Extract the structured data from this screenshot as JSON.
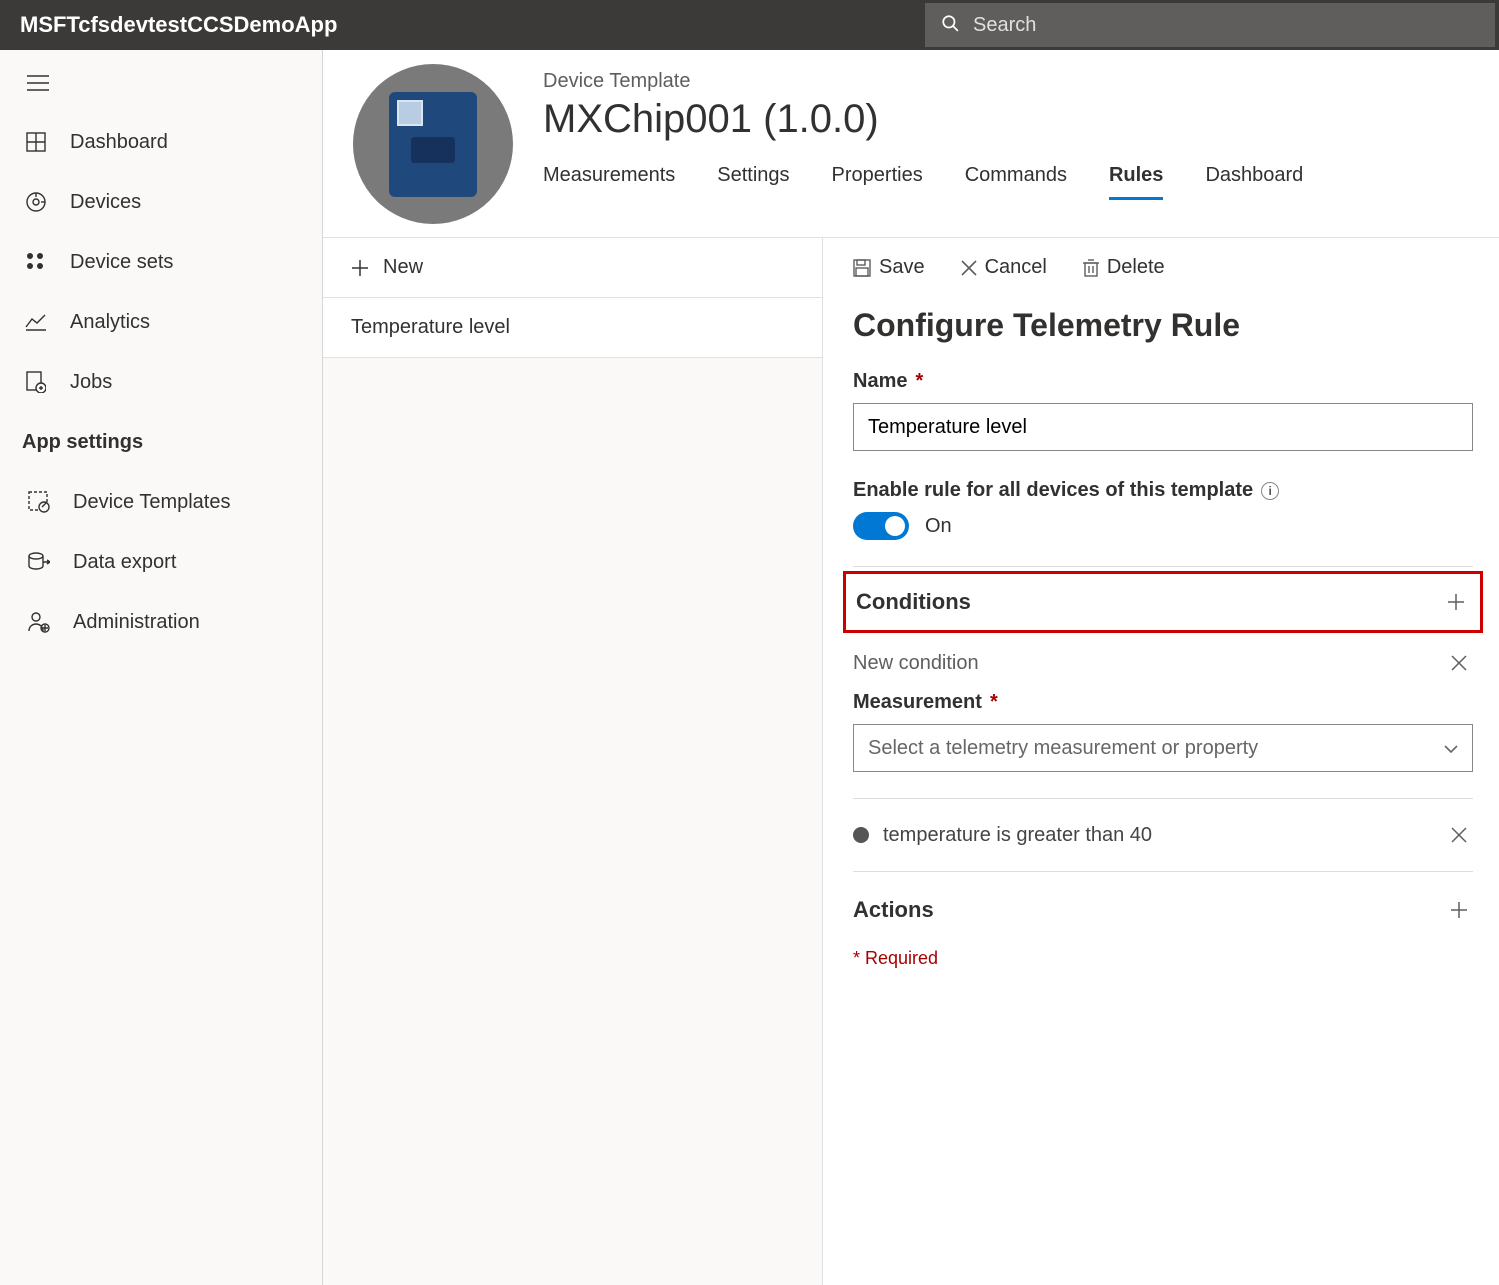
{
  "app_title": "MSFTcfsdevtestCCSDemoApp",
  "search": {
    "placeholder": "Search"
  },
  "sidebar": {
    "items": [
      {
        "label": "Dashboard"
      },
      {
        "label": "Devices"
      },
      {
        "label": "Device sets"
      },
      {
        "label": "Analytics"
      },
      {
        "label": "Jobs"
      }
    ],
    "section_header": "App settings",
    "settings_items": [
      {
        "label": "Device Templates"
      },
      {
        "label": "Data export"
      },
      {
        "label": "Administration"
      }
    ]
  },
  "template": {
    "breadcrumb": "Device Template",
    "title": "MXChip001  (1.0.0)",
    "tabs": [
      {
        "label": "Measurements"
      },
      {
        "label": "Settings"
      },
      {
        "label": "Properties"
      },
      {
        "label": "Commands"
      },
      {
        "label": "Rules",
        "active": true
      },
      {
        "label": "Dashboard"
      }
    ]
  },
  "rules_pane": {
    "new_label": "New",
    "rules": [
      {
        "label": "Temperature level"
      }
    ]
  },
  "details": {
    "actions": {
      "save": "Save",
      "cancel": "Cancel",
      "delete": "Delete"
    },
    "title": "Configure Telemetry Rule",
    "name_label": "Name",
    "name_value": "Temperature level",
    "enable_label": "Enable rule for all devices of this template",
    "enable_state": "On",
    "conditions": {
      "header": "Conditions",
      "new_condition_label": "New condition",
      "measurement_label": "Measurement",
      "measurement_placeholder": "Select a telemetry measurement or property",
      "existing": "temperature is greater than 40"
    },
    "actions_section": "Actions",
    "required_note": "* Required"
  }
}
